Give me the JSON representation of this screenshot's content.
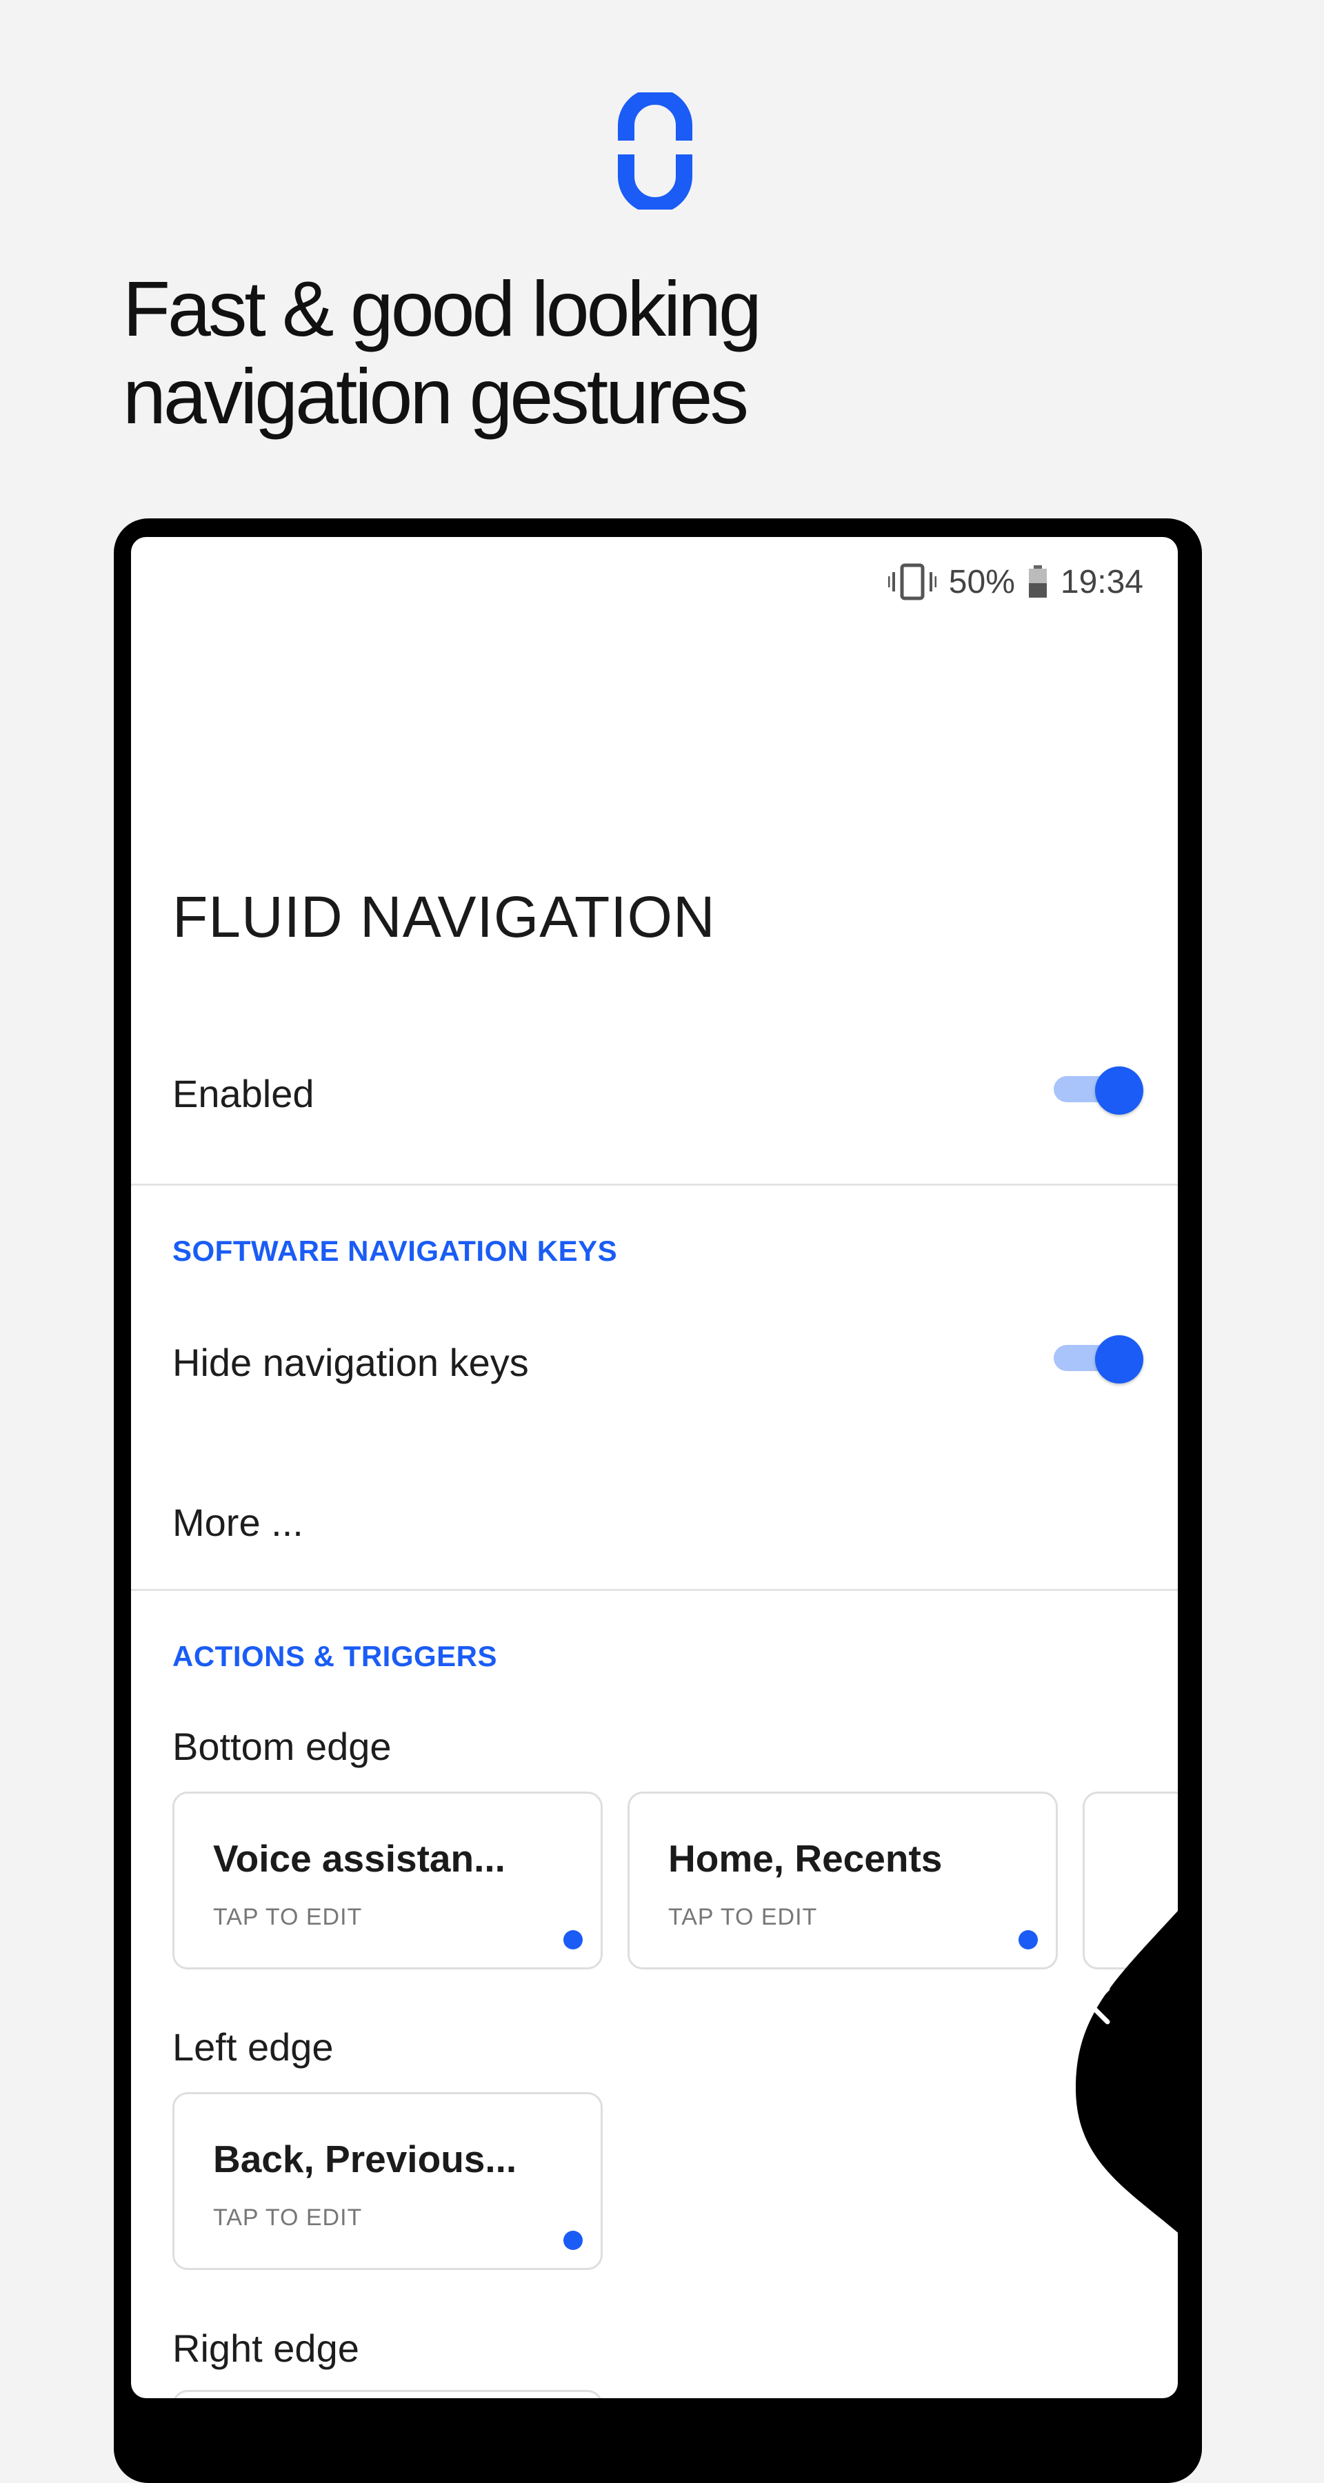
{
  "promo": {
    "headline_line1": "Fast & good looking",
    "headline_line2": "navigation gestures",
    "logo_icon": "fluid-navigation-logo-icon",
    "accent_color": "#1a5cf5"
  },
  "status_bar": {
    "battery_percent": "50%",
    "time": "19:34",
    "icons": [
      "vibrate-icon",
      "battery-icon"
    ]
  },
  "app": {
    "title": "FLUID NAVIGATION",
    "enabled_label": "Enabled",
    "enabled_on": true,
    "section_software": "SOFTWARE NAVIGATION KEYS",
    "hide_keys_label": "Hide navigation keys",
    "hide_keys_on": true,
    "more_label": "More ...",
    "section_actions": "ACTIONS & TRIGGERS",
    "bottom_edge_label": "Bottom edge",
    "left_edge_label": "Left edge",
    "right_edge_label": "Right edge",
    "cards": {
      "bottom": [
        {
          "title": "Voice assistan...",
          "subtitle": "TAP TO EDIT"
        },
        {
          "title": "Home, Recents",
          "subtitle": "TAP TO EDIT"
        }
      ],
      "left": [
        {
          "title": "Back, Previous...",
          "subtitle": "TAP TO EDIT"
        }
      ]
    },
    "edge_gesture_icon": "chevron-left-icon"
  }
}
